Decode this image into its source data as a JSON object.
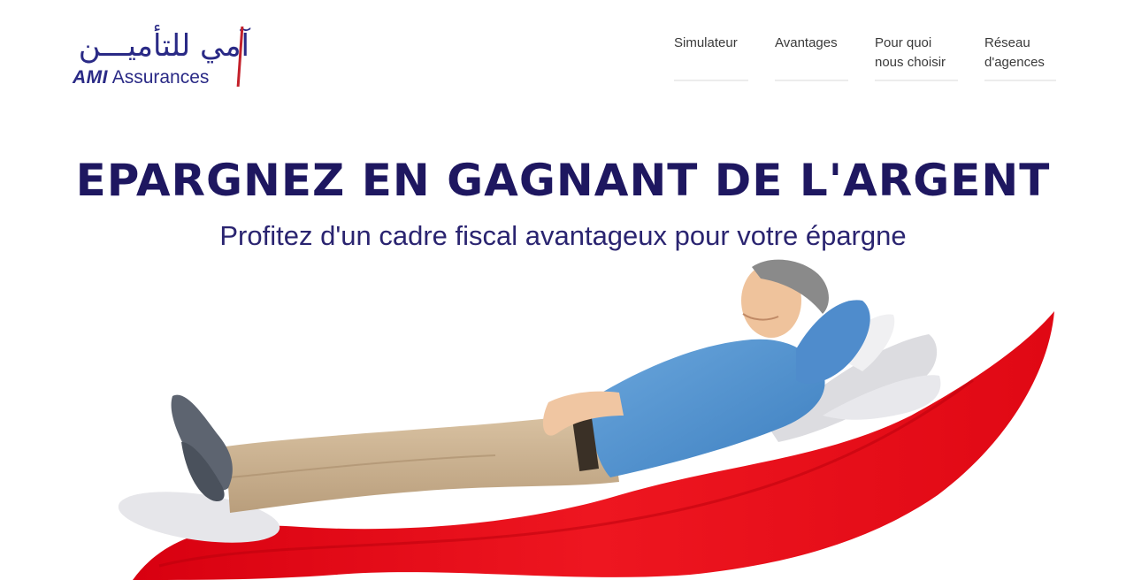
{
  "brand": {
    "arabic_name": "آمي للتأميـــن",
    "latin_bold": "AMI",
    "latin_rest": "Assurances",
    "primary_color": "#1e1760",
    "accent_color": "#e30613"
  },
  "nav": {
    "items": [
      {
        "line1": "Simulateur",
        "line2": ""
      },
      {
        "line1": "Avantages",
        "line2": ""
      },
      {
        "line1": "Pour quoi",
        "line2": "nous choisir"
      },
      {
        "line1": "Réseau",
        "line2": "d'agences"
      }
    ]
  },
  "hero": {
    "title": "EPARGNEZ EN GAGNANT DE L'ARGENT",
    "subtitle": "Profitez d'un cadre fiscal avantageux pour votre épargne",
    "image_icon": "man-relaxing-on-red-wave-illustration"
  }
}
